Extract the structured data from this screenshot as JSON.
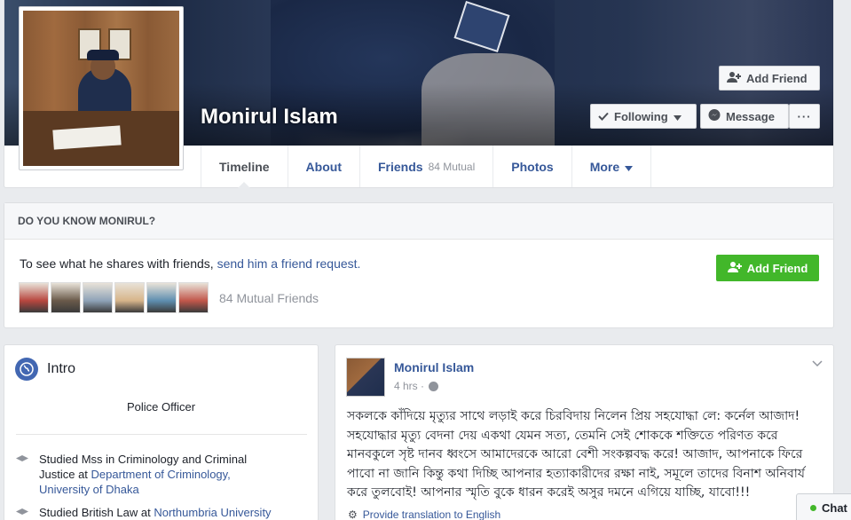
{
  "profile": {
    "name": "Monirul Islam"
  },
  "cover_actions": {
    "add_friend": "Add Friend",
    "following": "Following",
    "message": "Message",
    "more": "···"
  },
  "tabs": [
    {
      "label": "Timeline"
    },
    {
      "label": "About"
    },
    {
      "label": "Friends",
      "sub": "84 Mutual"
    },
    {
      "label": "Photos"
    },
    {
      "label": "More"
    }
  ],
  "know": {
    "heading": "DO YOU KNOW MONIRUL?",
    "text": "To see what he shares with friends,",
    "link": "send him a friend request.",
    "button": "Add Friend",
    "mutual_count": "84 Mutual Friends",
    "mutual_colors": [
      "#b8473f",
      "#6a5a4a",
      "#8fa3b8",
      "#d7b58a",
      "#5f8fb0",
      "#c2574b"
    ]
  },
  "intro": {
    "title": "Intro",
    "bio": "Police Officer",
    "items": [
      {
        "text": "Studied Mss in Criminology and Criminal Justice at ",
        "link": "Department of Criminology, University of Dhaka"
      },
      {
        "text": "Studied British Law at ",
        "link": "Northumbria University"
      }
    ]
  },
  "post": {
    "author": "Monirul Islam",
    "time": "4 hrs ·",
    "body": "সকলকে কাঁদিয়ে মৃত্যুর সাথে লড়াই করে চিরবিদায় নিলেন প্রিয় সহযোদ্ধা লে: কর্নেল আজাদ! সহযোদ্ধার মৃত্যু বেদনা দেয় একথা যেমন সত্য, তেমনি সেই শোককে শক্তিতে পরিণত করে মানবকুলে সৃষ্ট দানব ধ্বংসে আমাদেরকে আরো বেশী সংকল্পবদ্ধ করে! আজাদ, আপনাকে ফিরে পাবো না জানি কিন্তু কথা দিচ্ছি আপনার হত্যাকারীদের রক্ষা নাই, সমূলে তাদের বিনাশ অনিবার্য করে তুলবোই! আপনার স্মৃতি বুকে ধারন করেই অসুর দমনে এগিয়ে যাচ্ছি, যাবো!!!",
    "translate": "Provide translation to English"
  },
  "chat": {
    "label": "Chat"
  },
  "colors": {
    "link": "#365899",
    "green": "#42b72a",
    "bg": "#e9ebee"
  }
}
